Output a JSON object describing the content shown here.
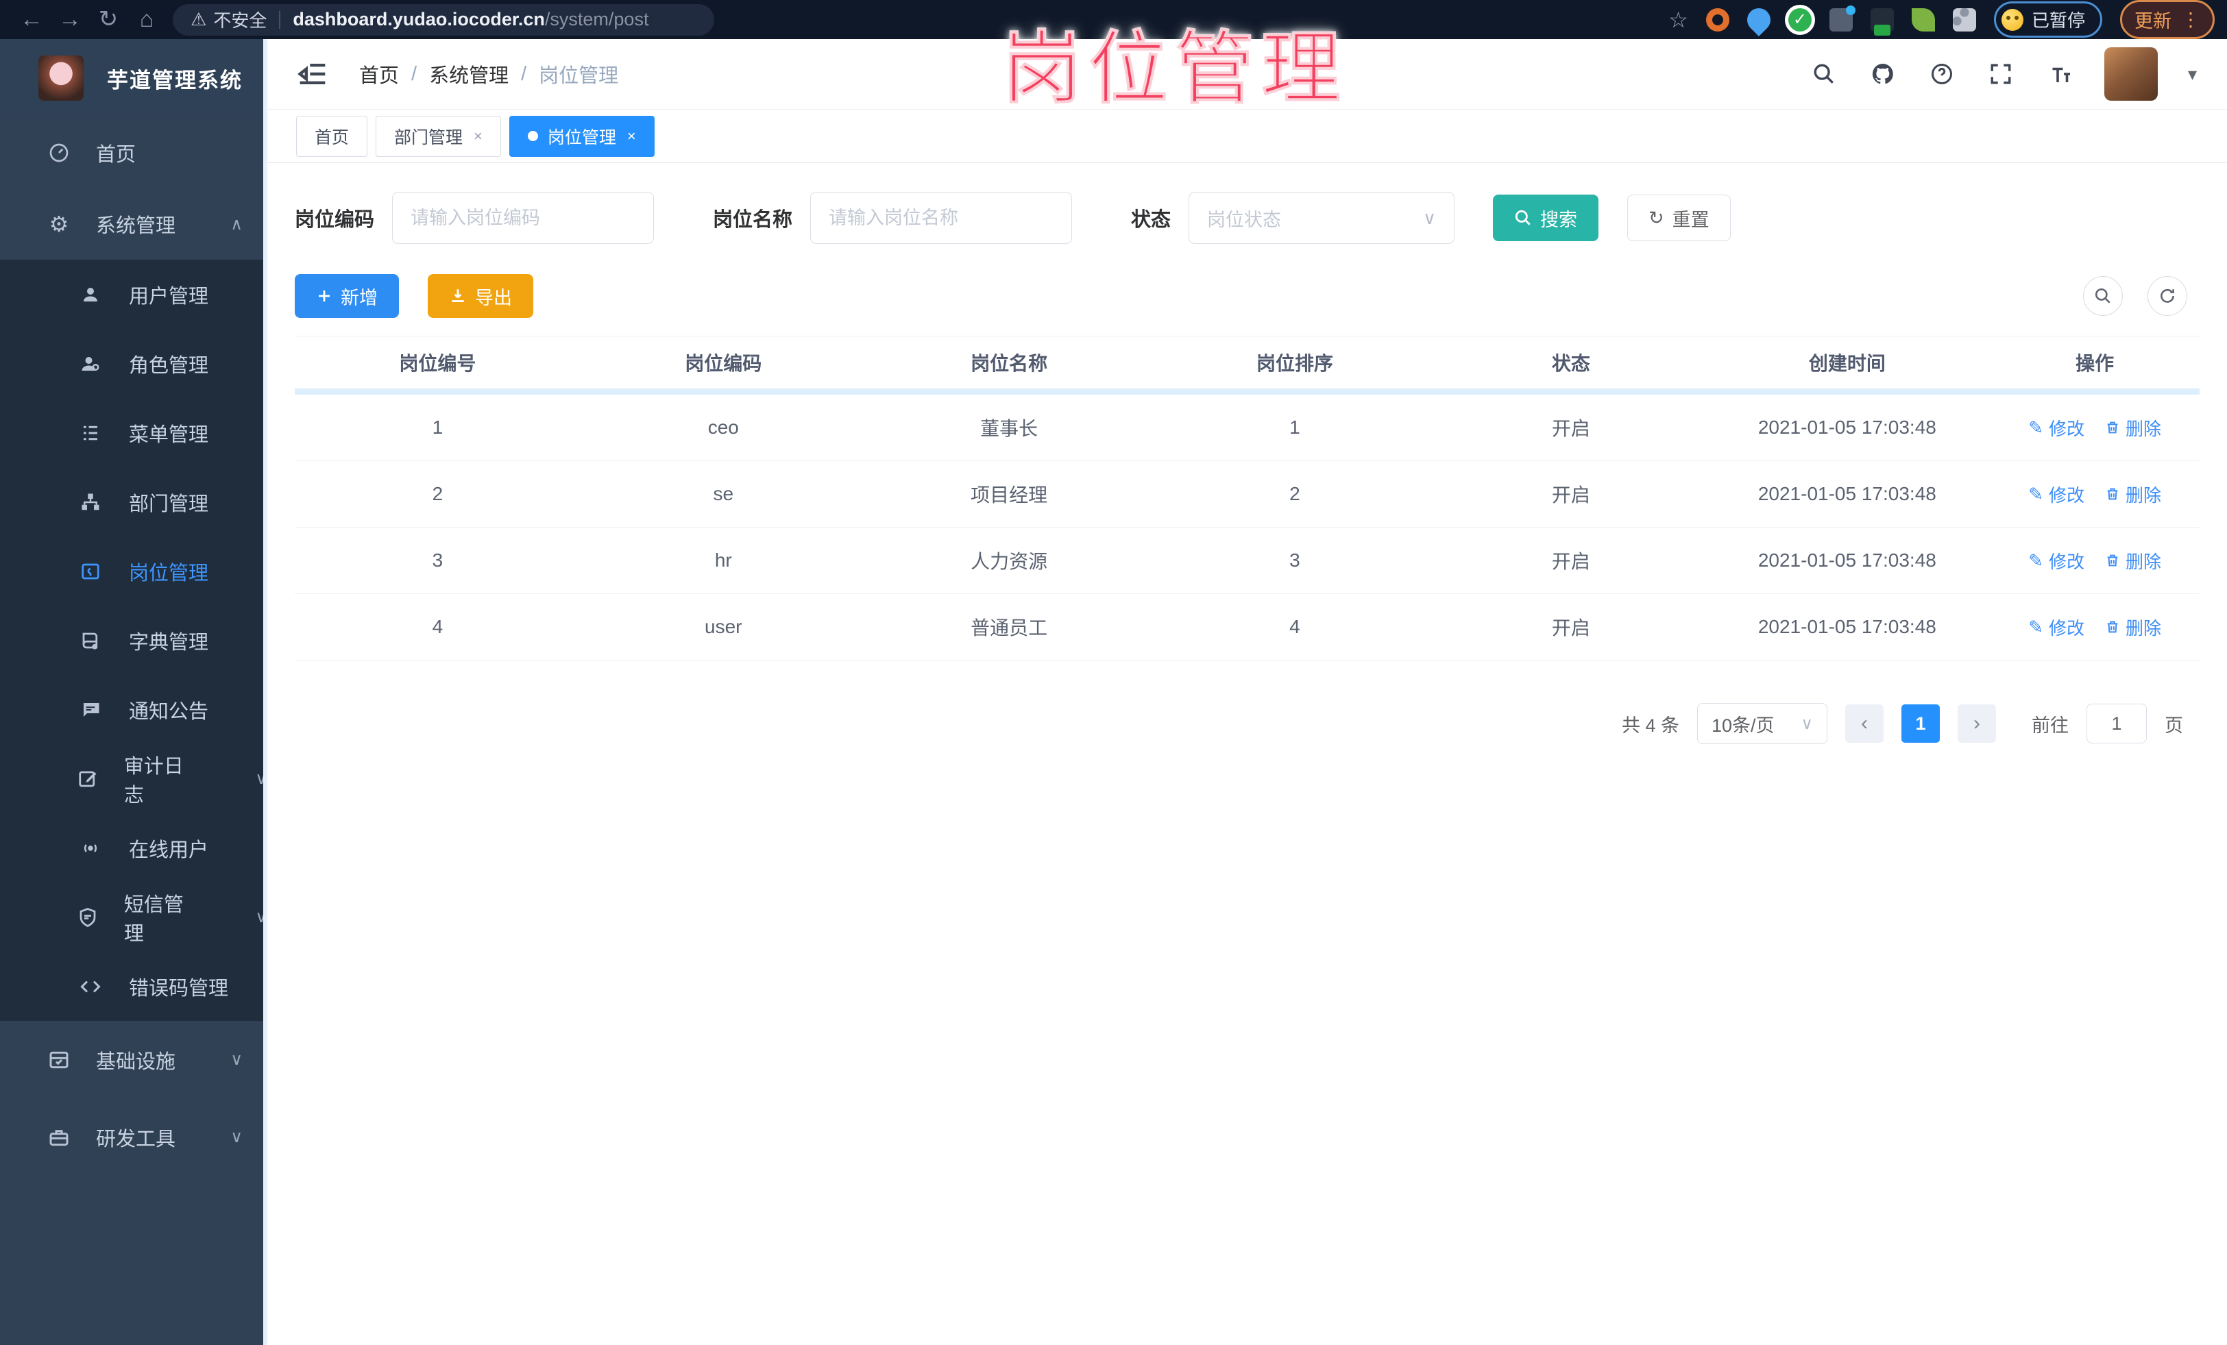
{
  "watermark": {
    "text": "岗位管理"
  },
  "browser": {
    "security_label": "不安全",
    "url_host": "dashboard.yudao.iocoder.cn",
    "url_path": "/system/post",
    "paused_label": "已暂停",
    "update_label": "更新"
  },
  "header": {
    "breadcrumb": [
      "首页",
      "系统管理",
      "岗位管理"
    ],
    "separator": "/"
  },
  "tabs": [
    {
      "label": "首页"
    },
    {
      "label": "部门管理"
    },
    {
      "label": "岗位管理"
    }
  ],
  "sidebar": {
    "app_title": "芋道管理系统",
    "home": "首页",
    "system": "系统管理",
    "submenu": [
      "用户管理",
      "角色管理",
      "菜单管理",
      "部门管理",
      "岗位管理",
      "字典管理",
      "通知公告",
      "审计日志",
      "在线用户",
      "短信管理",
      "错误码管理"
    ],
    "infra": "基础设施",
    "devtools": "研发工具"
  },
  "filters": {
    "code_label": "岗位编码",
    "code_placeholder": "请输入岗位编码",
    "name_label": "岗位名称",
    "name_placeholder": "请输入岗位名称",
    "status_label": "状态",
    "status_placeholder": "岗位状态",
    "search_label": "搜索",
    "reset_label": "重置"
  },
  "toolbar": {
    "add_label": "新增",
    "export_label": "导出"
  },
  "table": {
    "columns": [
      "岗位编号",
      "岗位编码",
      "岗位名称",
      "岗位排序",
      "状态",
      "创建时间",
      "操作"
    ],
    "edit_label": "修改",
    "delete_label": "删除",
    "rows": [
      {
        "id": "1",
        "code": "ceo",
        "name": "董事长",
        "sort": "1",
        "status": "开启",
        "created": "2021-01-05 17:03:48"
      },
      {
        "id": "2",
        "code": "se",
        "name": "项目经理",
        "sort": "2",
        "status": "开启",
        "created": "2021-01-05 17:03:48"
      },
      {
        "id": "3",
        "code": "hr",
        "name": "人力资源",
        "sort": "3",
        "status": "开启",
        "created": "2021-01-05 17:03:48"
      },
      {
        "id": "4",
        "code": "user",
        "name": "普通员工",
        "sort": "4",
        "status": "开启",
        "created": "2021-01-05 17:03:48"
      }
    ]
  },
  "pagination": {
    "total_label": "共 4 条",
    "page_size": "10条/页",
    "prev": "‹",
    "next": "›",
    "current_page": "1",
    "goto_label": "前往",
    "goto_value": "1",
    "page_unit": "页"
  }
}
